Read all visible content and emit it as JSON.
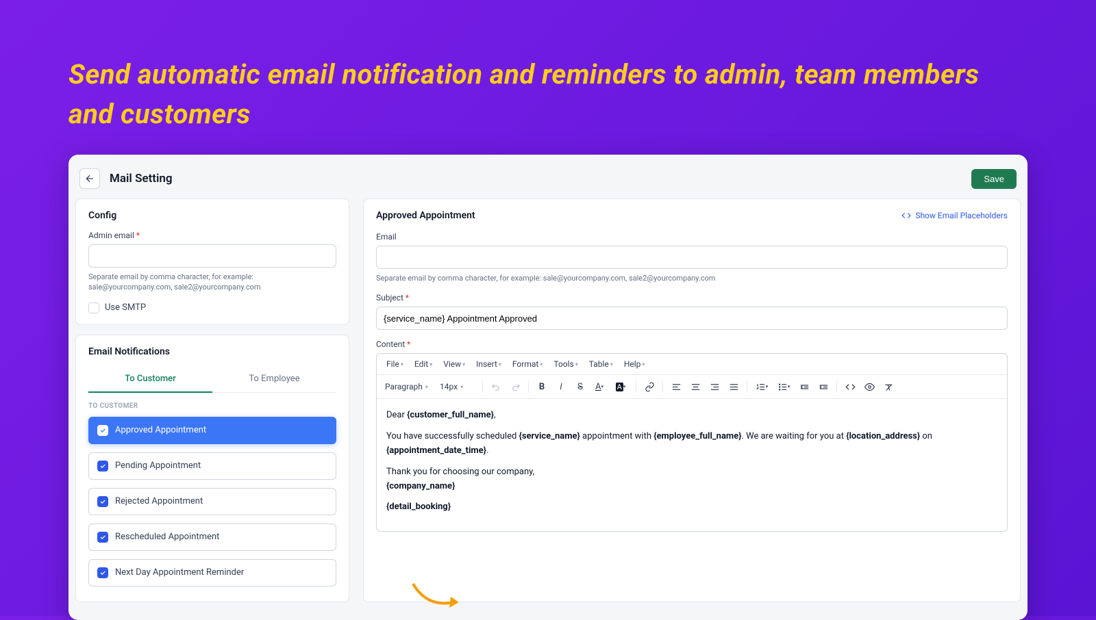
{
  "hero": "Send automatic email notification and reminders to admin, team members and customers",
  "header": {
    "title": "Mail Setting",
    "save": "Save"
  },
  "config": {
    "title": "Config",
    "admin_email_label": "Admin email",
    "admin_email_hint": "Separate email by comma character, for example: sale@yourcompany.com, sale2@yourcompany.com",
    "use_smtp_label": "Use SMTP"
  },
  "notifications": {
    "title": "Email Notifications",
    "tabs": {
      "customer": "To Customer",
      "employee": "To Employee"
    },
    "subhead": "TO CUSTOMER",
    "items": [
      {
        "label": "Approved Appointment",
        "active": true
      },
      {
        "label": "Pending Appointment",
        "active": false
      },
      {
        "label": "Rejected Appointment",
        "active": false
      },
      {
        "label": "Rescheduled Appointment",
        "active": false
      },
      {
        "label": "Next Day Appointment Reminder",
        "active": false
      }
    ]
  },
  "detail": {
    "title": "Approved Appointment",
    "placeholders_link": "Show Email Placeholders",
    "email_label": "Email",
    "email_hint": "Separate email by comma character, for example: sale@yourcompany.com, sale2@yourcompany.com",
    "subject_label": "Subject",
    "subject_value": "{service_name} Appointment Approved",
    "content_label": "Content",
    "menus": [
      "File",
      "Edit",
      "View",
      "Insert",
      "Format",
      "Tools",
      "Table",
      "Help"
    ],
    "font_style": "Paragraph",
    "font_size": "14px",
    "body": {
      "line1_a": "Dear ",
      "line1_b": "{customer_full_name}",
      "line1_c": ",",
      "line2_a": "You have successfully scheduled ",
      "line2_b": "{service_name}",
      "line2_c": " appointment with ",
      "line2_d": "{employee_full_name}",
      "line2_e": ". We are waiting for you at ",
      "line2_f": "{location_address}",
      "line2_g": " on ",
      "line2_h": "{appointment_date_time}",
      "line2_i": ".",
      "line3": "Thank you for choosing our company,",
      "line4": "{company_name}",
      "line5": "{detail_booking}"
    }
  }
}
